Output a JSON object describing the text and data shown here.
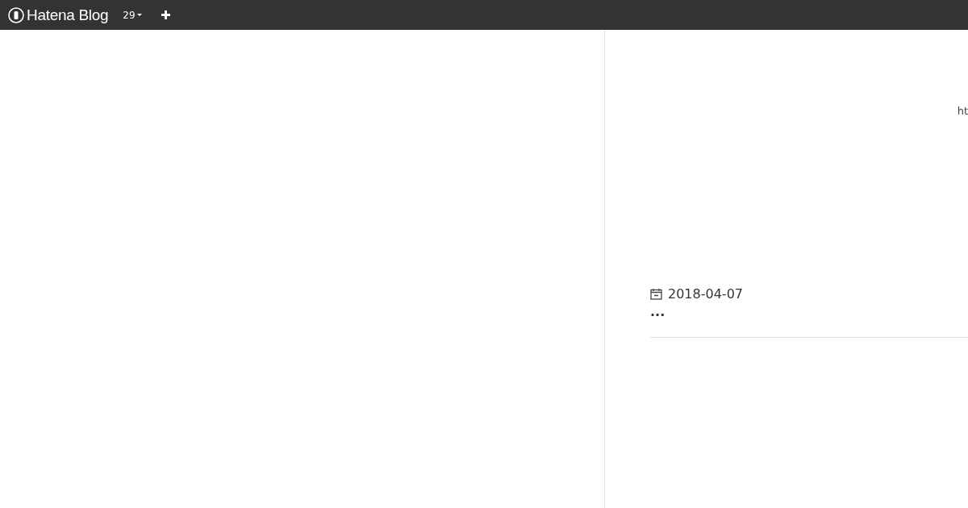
{
  "header": {
    "logo": "Hatena Blog",
    "count": "29"
  },
  "entry": {
    "url_fragment": "ht",
    "date": "2018-04-07",
    "ellipsis": "..."
  }
}
